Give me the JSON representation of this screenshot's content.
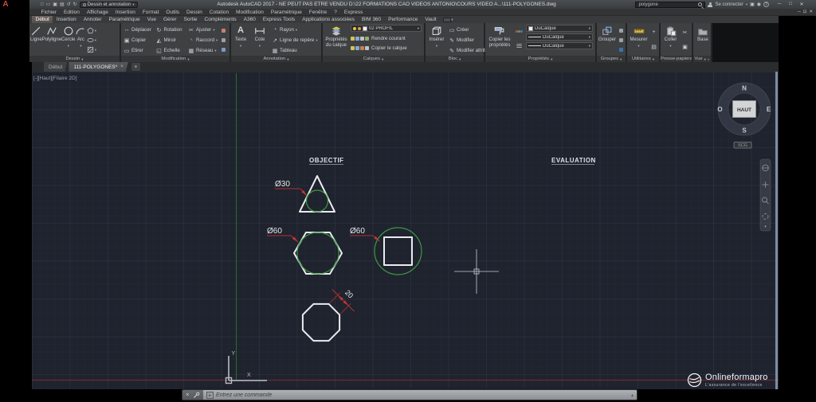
{
  "window": {
    "title": "Autodesk AutoCAD 2017 - NE PEUT PAS ETRE VENDU   D:\\22 FORMATIONS CAO VIDEOS ANTONIO\\COURS VIDEO A...\\111-POLYGONES.dwg",
    "workspace": "Dessin et annotation",
    "search_value": "polygone",
    "signin_label": "Se connecter"
  },
  "menu": [
    "Fichier",
    "Edition",
    "Affichage",
    "Insertion",
    "Format",
    "Outils",
    "Dessin",
    "Cotation",
    "Modification",
    "Paramétrique",
    "Fenêtre",
    "?",
    "Express"
  ],
  "ribbon_tabs": [
    "Début",
    "Insertion",
    "Annoter",
    "Paramétrique",
    "Vue",
    "Gérer",
    "Sortie",
    "Compléments",
    "A360",
    "Express Tools",
    "Applications associées",
    "BIM 360",
    "Performance",
    "Vault"
  ],
  "panels": {
    "dessin": {
      "label": "Dessin",
      "ligne": "Ligne",
      "polyligne": "Polyligne",
      "cercle": "Cercle",
      "arc": "Arc"
    },
    "modification": {
      "label": "Modification",
      "items": [
        "Déplacer",
        "Copier",
        "Etirer",
        "Rotation",
        "Miroir",
        "Echelle",
        "Ajuster",
        "Raccord",
        "Réseau"
      ]
    },
    "annotation": {
      "label": "Annotation",
      "texte": "Texte",
      "cote": "Cote",
      "rayon": "Rayon",
      "ligne_repere": "Ligne de repère",
      "tableau": "Tableau"
    },
    "calques": {
      "label": "Calques",
      "proprietes": "Propriétés du calque",
      "layer_value": "02 PROFIL",
      "rendre": "Rendre courant",
      "copier": "Copier le calque"
    },
    "bloc": {
      "label": "Bloc",
      "inserer": "Insérer",
      "creer": "Créer",
      "modifier": "Modifier",
      "attributs": "Modifier attributs"
    },
    "proprietes": {
      "label": "Propriétés",
      "copier": "Copier les propriétés",
      "combo1": "DuCalque",
      "combo2": "DuCalque",
      "combo3": "DuCalque"
    },
    "groupes": {
      "label": "Groupes",
      "grouper": "Grouper"
    },
    "utilitaires": {
      "label": "Utilitaires",
      "mesurer": "Mesurer"
    },
    "presse_papiers": {
      "label": "Presse-papiers",
      "coller": "Coller"
    },
    "vue": {
      "label": "Vue",
      "base": "Base"
    }
  },
  "file_tabs": {
    "start": "Début",
    "drawing": "111-POLYGONES*"
  },
  "canvas": {
    "viewport_label": "[-][Haut][Filaire 2D]",
    "objectif": "OBJECTIF",
    "evaluation": "EVALUATION",
    "dim_triangle": "Ø30",
    "dim_hexagon": "Ø60",
    "dim_square": "Ø60",
    "dim_octagon": "20",
    "axis_x": "X",
    "axis_y": "Y",
    "viewcube": {
      "n": "N",
      "e": "E",
      "s": "S",
      "o": "O",
      "top": "HAUT",
      "scg": "SCG"
    }
  },
  "command": {
    "prompt": "Entrez une commande"
  },
  "watermark": {
    "brand": "Onlineformapro",
    "tagline": "L'assurance de l'excellence"
  },
  "colors": {
    "shape_stroke": "#e9ebee",
    "inscribed_circle_green": "#3c9a41",
    "dimension_red": "#b23232",
    "axis_green": "#2e6b2e",
    "axis_red": "#7e2a2a",
    "canvas_bg": "#1f232e",
    "ribbon_bg": "#3e4042"
  }
}
